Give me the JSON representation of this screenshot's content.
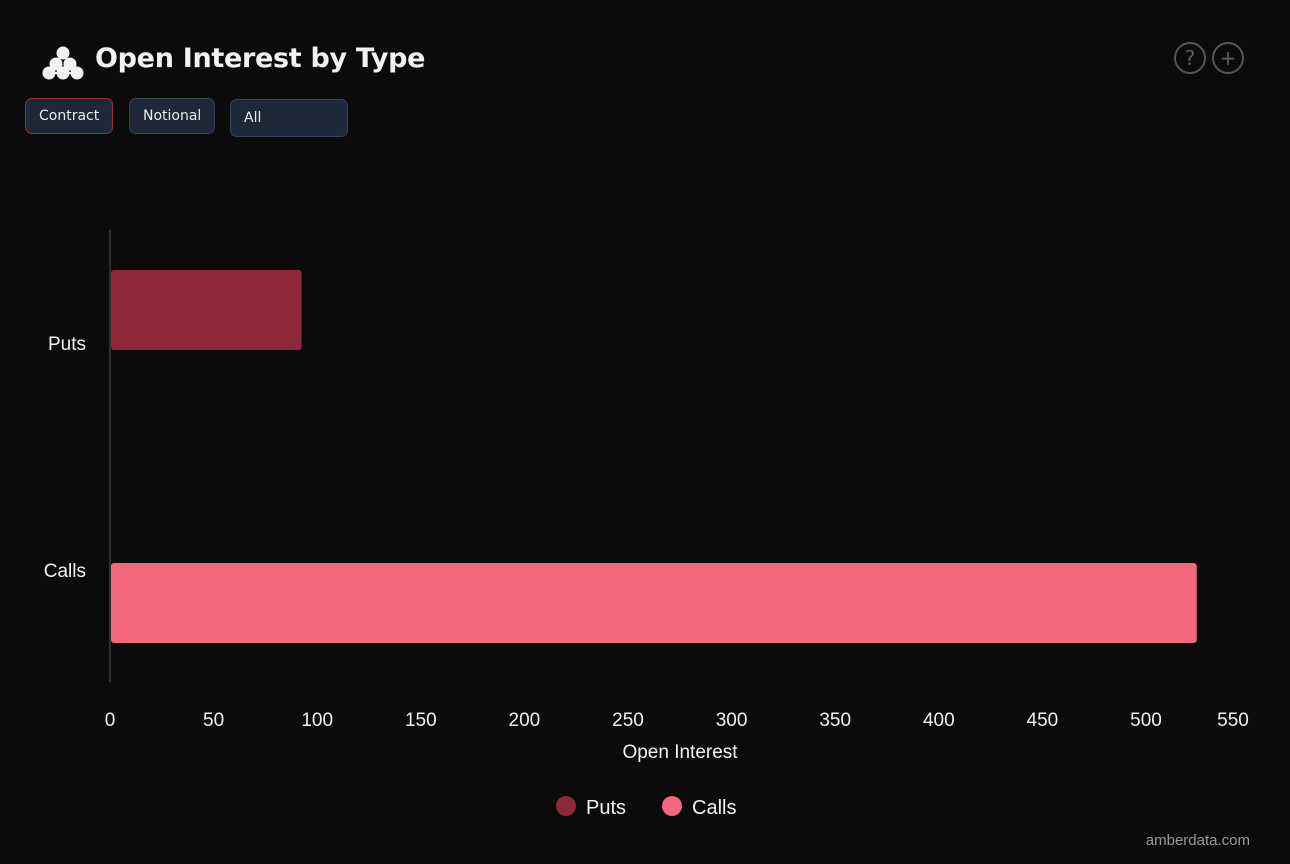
{
  "header": {
    "title": "Open Interest by Type",
    "logo_icon": "amberdata-logo",
    "help_icon": "question-circle-icon",
    "add_icon": "plus-circle-icon"
  },
  "controls": {
    "buttons": [
      {
        "label": "Contract",
        "active": true
      },
      {
        "label": "Notional",
        "active": false
      }
    ],
    "select": {
      "value": "All"
    }
  },
  "colors": {
    "background": "#0b0b0b",
    "puts": "#8e2838",
    "calls": "#f2687c",
    "active_border": "#9b2a3a"
  },
  "chart_data": {
    "type": "bar",
    "orientation": "horizontal",
    "title": "Open Interest by Type",
    "categories": [
      "Puts",
      "Calls"
    ],
    "series": [
      {
        "name": "Puts",
        "color": "#8e2838",
        "values": [
          92,
          null
        ]
      },
      {
        "name": "Calls",
        "color": "#f2687c",
        "values": [
          null,
          524
        ]
      }
    ],
    "values": [
      92,
      524
    ],
    "xlabel": "Open Interest",
    "ylabel": "",
    "xlim": [
      0,
      550
    ],
    "xticks": [
      "0",
      "50",
      "100",
      "150",
      "200",
      "250",
      "300",
      "350",
      "400",
      "450",
      "500",
      "550"
    ],
    "grid": false,
    "legend": {
      "position": "bottom-center",
      "entries": [
        "Puts",
        "Calls"
      ]
    }
  },
  "footer": {
    "watermark": "amberdata.com"
  }
}
